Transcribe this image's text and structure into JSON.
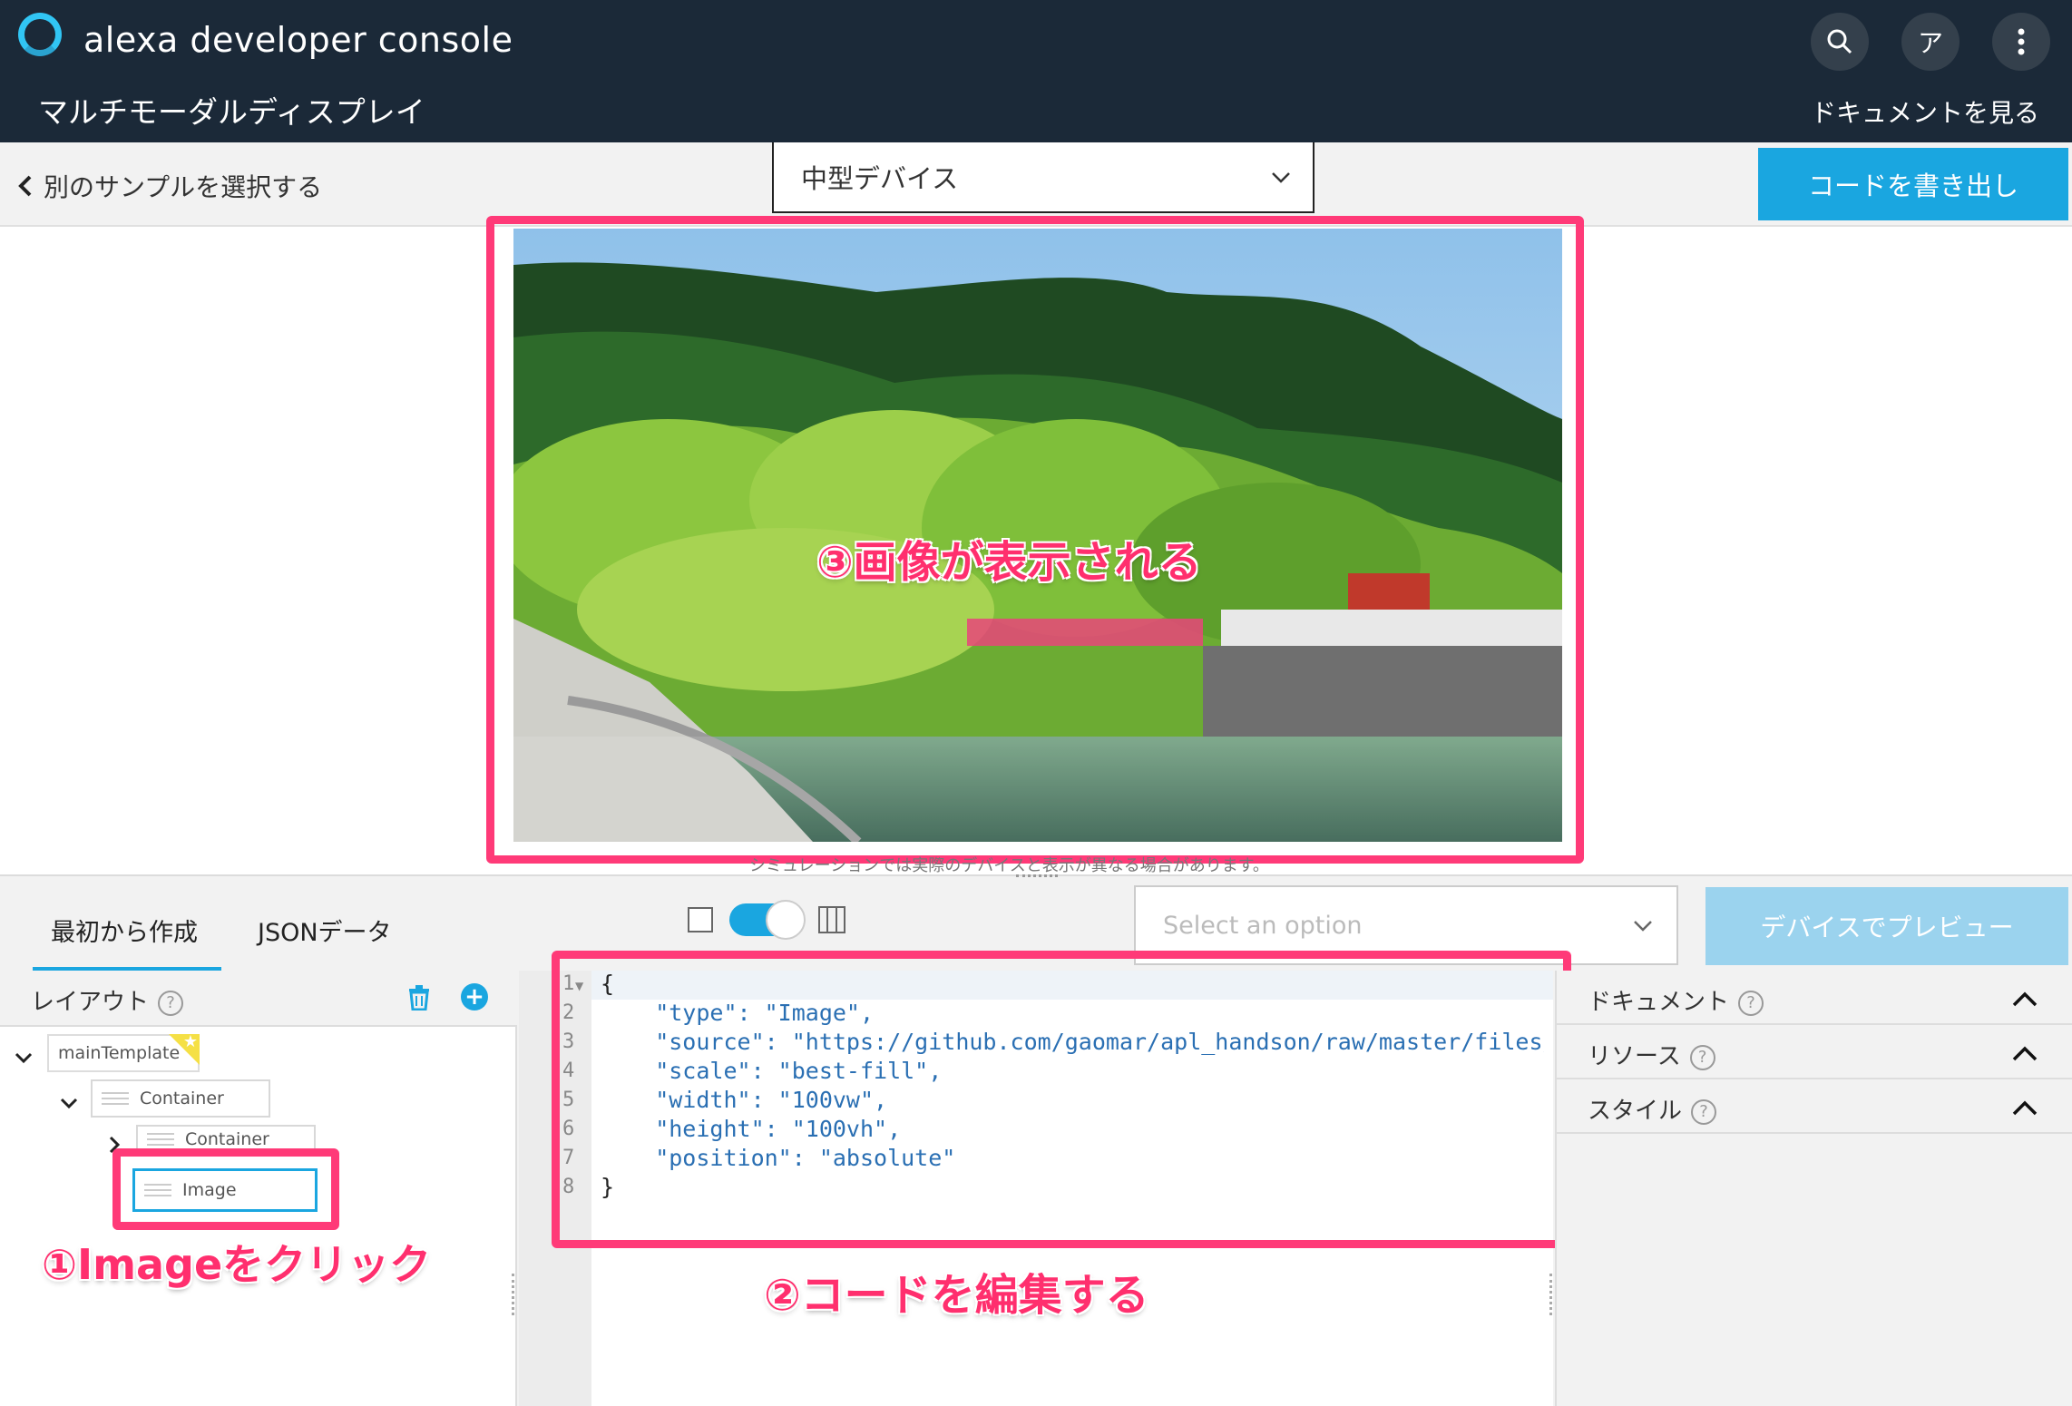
{
  "header": {
    "app_title": "alexa developer console",
    "page_title": "マルチモーダルディスプレイ",
    "search_icon": "search-icon",
    "avatar_label": "ア",
    "menu_icon": "more-vertical-icon",
    "doc_link": "ドキュメントを見る"
  },
  "toolbar": {
    "back_label": "別のサンプルを選択する",
    "device_select_value": "中型デバイス",
    "export_label": "コードを書き出し"
  },
  "canvas": {
    "simulation_note": "シミュレーションでは実際のデバイスと表示が異なる場合があります。",
    "annotation_image": "③画像が表示される"
  },
  "tabs": [
    {
      "label": "最初から作成",
      "active": true
    },
    {
      "label": "JSONデータ",
      "active": false
    }
  ],
  "option_select": {
    "placeholder": "Select an option"
  },
  "preview_label": "デバイスでプレビュー",
  "layout_panel": {
    "title": "レイアウト",
    "nodes": [
      {
        "label": "mainTemplate"
      },
      {
        "label": "Container"
      },
      {
        "label": "Container"
      },
      {
        "label": "Image"
      }
    ],
    "annotation_click": "①Imageをクリック"
  },
  "editor": {
    "line_numbers": [
      "1",
      "2",
      "3",
      "4",
      "5",
      "6",
      "7",
      "8"
    ],
    "lines": [
      "{",
      "    \"type\": \"Image\",",
      "    \"source\": \"https://github.com/gaomar/apl_handson/raw/master/files/bac",
      "    \"scale\": \"best-fill\",",
      "    \"width\": \"100vw\",",
      "    \"height\": \"100vh\",",
      "    \"position\": \"absolute\"",
      "}"
    ],
    "annotation_edit": "②コードを編集する"
  },
  "right_panel": {
    "sections": [
      {
        "label": "ドキュメント"
      },
      {
        "label": "リソース"
      },
      {
        "label": "スタイル"
      }
    ]
  },
  "colors": {
    "topbar": "#1b2938",
    "accent": "#1aa6e0",
    "annotation": "#ff3a78"
  }
}
